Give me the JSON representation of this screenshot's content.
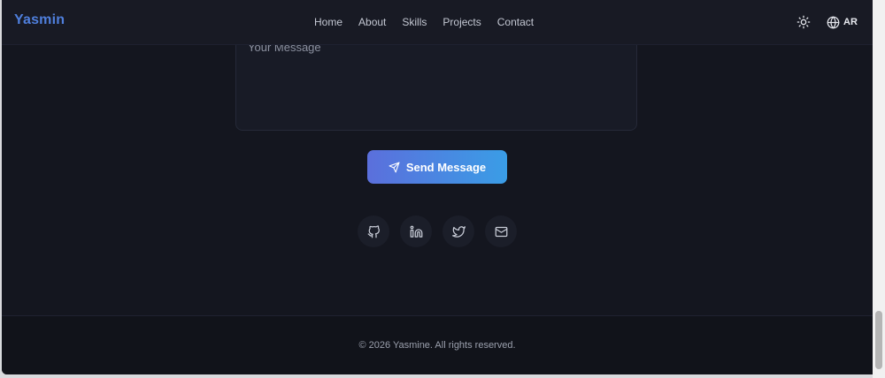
{
  "header": {
    "brand": "Yasmin",
    "nav": [
      "Home",
      "About",
      "Skills",
      "Projects",
      "Contact"
    ],
    "theme_icon": "sun-icon",
    "lang_icon": "globe-icon",
    "lang_label": "AR"
  },
  "form": {
    "message_placeholder": "Your Message",
    "send_label": "Send Message",
    "send_icon": "send-icon"
  },
  "social": [
    "github-icon",
    "linkedin-icon",
    "twitter-icon",
    "mail-icon"
  ],
  "footer": {
    "copyright": "© 2026 Yasmine. All rights reserved."
  },
  "colors": {
    "background": "#14161f",
    "brand": "#4f7fdc",
    "button_start": "#5b6fdc",
    "button_end": "#3a9de6"
  }
}
